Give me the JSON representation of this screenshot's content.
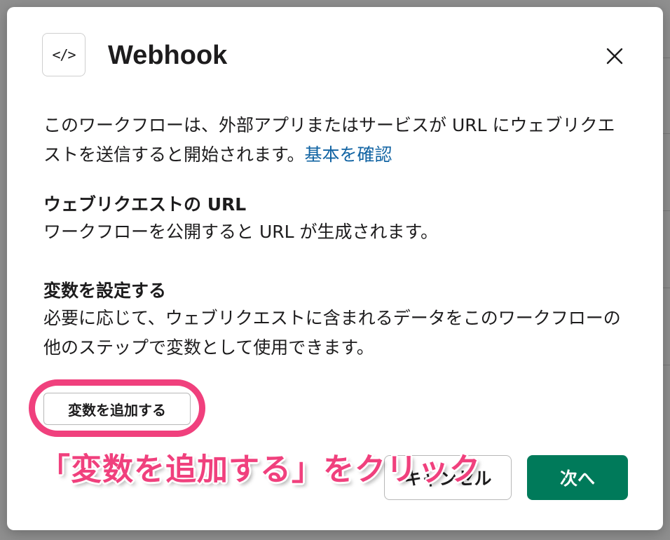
{
  "modal": {
    "icon_glyph": "</>",
    "title": "Webhook",
    "description": "このワークフローは、外部アプリまたはサービスが URL にウェブリクエストを送信すると開始されます。",
    "learn_more_link": "基本を確認",
    "sections": [
      {
        "heading": "ウェブリクエストの URL",
        "body": "ワークフローを公開すると URL が生成されます。"
      },
      {
        "heading": "変数を設定する",
        "body": "必要に応じて、ウェブリクエストに含まれるデータをこのワークフローの他のステップで変数として使用できます。"
      }
    ],
    "add_variable_button": "変数を追加する",
    "cancel_button": "キャンセル",
    "next_button": "次へ"
  },
  "annotation": {
    "text": "「変数を追加する」をクリック",
    "color": "#f0407d"
  },
  "colors": {
    "primary_button": "#007a5a",
    "link": "#1264a3",
    "text": "#1d1c1d"
  }
}
